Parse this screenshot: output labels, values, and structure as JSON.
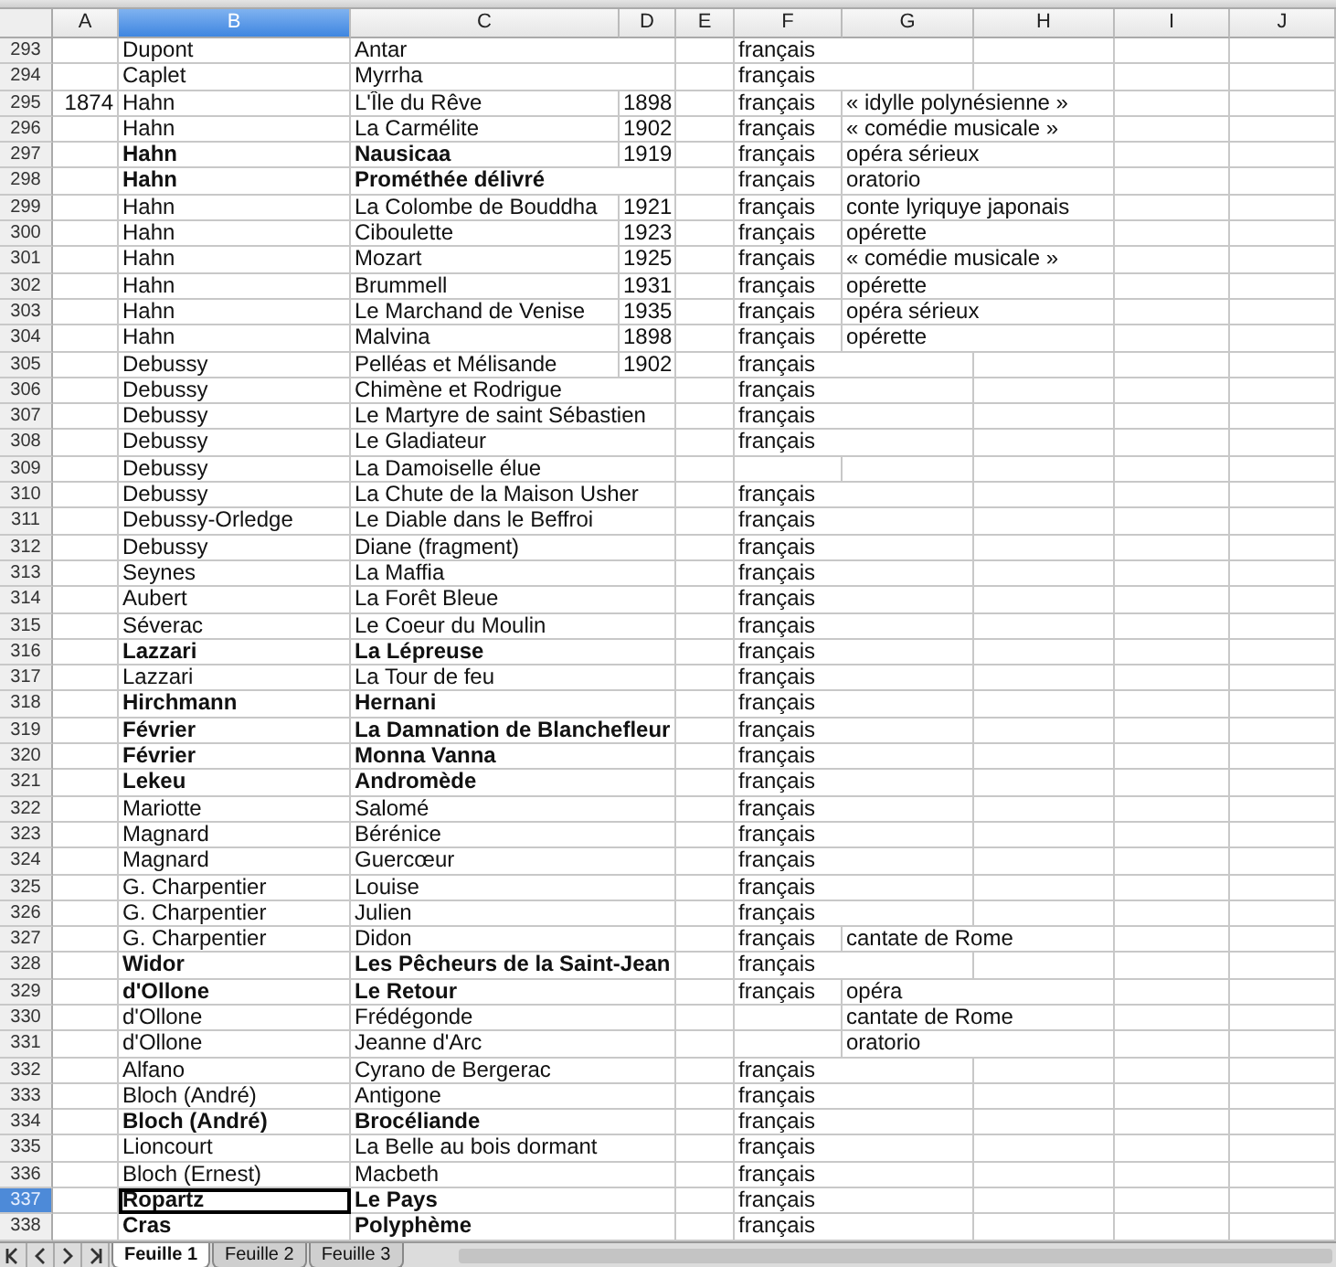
{
  "columns": [
    {
      "label": "A",
      "selected": false
    },
    {
      "label": "B",
      "selected": true
    },
    {
      "label": "C",
      "selected": false
    },
    {
      "label": "D",
      "selected": false
    },
    {
      "label": "E",
      "selected": false
    },
    {
      "label": "F",
      "selected": false
    },
    {
      "label": "G",
      "selected": false
    },
    {
      "label": "H",
      "selected": false
    },
    {
      "label": "I",
      "selected": false
    },
    {
      "label": "J",
      "selected": false
    }
  ],
  "rows": [
    {
      "num": "293",
      "cells": {
        "B": "Dupont",
        "C": "Antar",
        "F": "français"
      },
      "bold": false,
      "selected": false
    },
    {
      "num": "294",
      "cells": {
        "B": "Caplet",
        "C": "Myrrha",
        "F": "français"
      },
      "bold": false,
      "selected": false
    },
    {
      "num": "295",
      "cells": {
        "A": "1874",
        "B": "Hahn",
        "C": "L'Île du Rêve",
        "D": "1898",
        "F": "français",
        "G": "« idylle polynésienne »"
      },
      "bold": false,
      "selected": false
    },
    {
      "num": "296",
      "cells": {
        "B": "Hahn",
        "C": "La Carmélite",
        "D": "1902",
        "F": "français",
        "G": "« comédie musicale »"
      },
      "bold": false,
      "selected": false
    },
    {
      "num": "297",
      "cells": {
        "B": "Hahn",
        "C": "Nausicaa",
        "D": "1919",
        "F": "français",
        "G": "opéra sérieux"
      },
      "bold": true,
      "selected": false
    },
    {
      "num": "298",
      "cells": {
        "B": "Hahn",
        "C": "Prométhée délivré",
        "F": "français",
        "G": "oratorio"
      },
      "bold": true,
      "selected": false
    },
    {
      "num": "299",
      "cells": {
        "B": "Hahn",
        "C": "La Colombe de Bouddha",
        "D": "1921",
        "F": "français",
        "G": "conte lyriquye japonais"
      },
      "bold": false,
      "selected": false
    },
    {
      "num": "300",
      "cells": {
        "B": "Hahn",
        "C": "Ciboulette",
        "D": "1923",
        "F": "français",
        "G": "opérette"
      },
      "bold": false,
      "selected": false
    },
    {
      "num": "301",
      "cells": {
        "B": "Hahn",
        "C": "Mozart",
        "D": "1925",
        "F": "français",
        "G": "« comédie musicale »"
      },
      "bold": false,
      "selected": false
    },
    {
      "num": "302",
      "cells": {
        "B": "Hahn",
        "C": "Brummell",
        "D": "1931",
        "F": "français",
        "G": "opérette"
      },
      "bold": false,
      "selected": false
    },
    {
      "num": "303",
      "cells": {
        "B": "Hahn",
        "C": "Le Marchand de Venise",
        "D": "1935",
        "F": "français",
        "G": "opéra sérieux"
      },
      "bold": false,
      "selected": false
    },
    {
      "num": "304",
      "cells": {
        "B": "Hahn",
        "C": "Malvina",
        "D": "1898",
        "F": "français",
        "G": "opérette"
      },
      "bold": false,
      "selected": false
    },
    {
      "num": "305",
      "cells": {
        "B": "Debussy",
        "C": "Pelléas et Mélisande",
        "D": "1902",
        "F": "français"
      },
      "bold": false,
      "selected": false
    },
    {
      "num": "306",
      "cells": {
        "B": "Debussy",
        "C": "Chimène et Rodrigue",
        "F": "français"
      },
      "bold": false,
      "selected": false
    },
    {
      "num": "307",
      "cells": {
        "B": "Debussy",
        "C": "Le Martyre de saint Sébastien",
        "F": "français"
      },
      "bold": false,
      "selected": false
    },
    {
      "num": "308",
      "cells": {
        "B": "Debussy",
        "C": "Le Gladiateur",
        "F": "français"
      },
      "bold": false,
      "selected": false
    },
    {
      "num": "309",
      "cells": {
        "B": "Debussy",
        "C": "La Damoiselle élue"
      },
      "bold": false,
      "selected": false
    },
    {
      "num": "310",
      "cells": {
        "B": "Debussy",
        "C": "La Chute de la Maison Usher",
        "F": "français"
      },
      "bold": false,
      "selected": false
    },
    {
      "num": "311",
      "cells": {
        "B": "Debussy-Orledge",
        "C": "Le Diable dans le Beffroi",
        "F": "français"
      },
      "bold": false,
      "selected": false
    },
    {
      "num": "312",
      "cells": {
        "B": "Debussy",
        "C": "Diane (fragment)",
        "F": "français"
      },
      "bold": false,
      "selected": false
    },
    {
      "num": "313",
      "cells": {
        "B": "Seynes",
        "C": "La Maffia",
        "F": "français"
      },
      "bold": false,
      "selected": false
    },
    {
      "num": "314",
      "cells": {
        "B": "Aubert",
        "C": "La Forêt Bleue",
        "F": "français"
      },
      "bold": false,
      "selected": false
    },
    {
      "num": "315",
      "cells": {
        "B": "Séverac",
        "C": "Le Coeur du Moulin",
        "F": "français"
      },
      "bold": false,
      "selected": false
    },
    {
      "num": "316",
      "cells": {
        "B": "Lazzari",
        "C": "La Lépreuse",
        "F": "français"
      },
      "bold": true,
      "selected": false
    },
    {
      "num": "317",
      "cells": {
        "B": "Lazzari",
        "C": "La Tour de feu",
        "F": "français"
      },
      "bold": false,
      "selected": false
    },
    {
      "num": "318",
      "cells": {
        "B": "Hirchmann",
        "C": "Hernani",
        "F": "français"
      },
      "bold": true,
      "selected": false
    },
    {
      "num": "319",
      "cells": {
        "B": "Février",
        "C": "La Damnation de Blanchefleur",
        "F": "français"
      },
      "bold": true,
      "selected": false
    },
    {
      "num": "320",
      "cells": {
        "B": "Février",
        "C": "Monna Vanna",
        "F": "français"
      },
      "bold": true,
      "selected": false
    },
    {
      "num": "321",
      "cells": {
        "B": "Lekeu",
        "C": "Andromède",
        "F": "français"
      },
      "bold": true,
      "selected": false
    },
    {
      "num": "322",
      "cells": {
        "B": "Mariotte",
        "C": "Salomé",
        "F": "français"
      },
      "bold": false,
      "selected": false
    },
    {
      "num": "323",
      "cells": {
        "B": "Magnard",
        "C": "Bérénice",
        "F": "français"
      },
      "bold": false,
      "selected": false
    },
    {
      "num": "324",
      "cells": {
        "B": "Magnard",
        "C": "Guercœur",
        "F": "français"
      },
      "bold": false,
      "selected": false
    },
    {
      "num": "325",
      "cells": {
        "B": "G. Charpentier",
        "C": "Louise",
        "F": "français"
      },
      "bold": false,
      "selected": false
    },
    {
      "num": "326",
      "cells": {
        "B": "G. Charpentier",
        "C": "Julien",
        "F": "français"
      },
      "bold": false,
      "selected": false
    },
    {
      "num": "327",
      "cells": {
        "B": "G. Charpentier",
        "C": "Didon",
        "F": "français",
        "G": "cantate de Rome"
      },
      "bold": false,
      "selected": false
    },
    {
      "num": "328",
      "cells": {
        "B": "Widor",
        "C": "Les Pêcheurs de la Saint-Jean",
        "F": "français"
      },
      "bold": true,
      "selected": false
    },
    {
      "num": "329",
      "cells": {
        "B": "d'Ollone",
        "C": "Le Retour",
        "F": "français",
        "G": "opéra"
      },
      "bold": true,
      "selected": false
    },
    {
      "num": "330",
      "cells": {
        "B": "d'Ollone",
        "C": "Frédégonde",
        "G": "cantate de Rome"
      },
      "bold": false,
      "selected": false
    },
    {
      "num": "331",
      "cells": {
        "B": "d'Ollone",
        "C": "Jeanne d'Arc",
        "G": "oratorio"
      },
      "bold": false,
      "selected": false
    },
    {
      "num": "332",
      "cells": {
        "B": "Alfano",
        "C": "Cyrano de Bergerac",
        "F": "français"
      },
      "bold": false,
      "selected": false
    },
    {
      "num": "333",
      "cells": {
        "B": "Bloch (André)",
        "C": "Antigone",
        "F": "français"
      },
      "bold": false,
      "selected": false
    },
    {
      "num": "334",
      "cells": {
        "B": "Bloch (André)",
        "C": "Brocéliande",
        "F": "français"
      },
      "bold": true,
      "selected": false
    },
    {
      "num": "335",
      "cells": {
        "B": "Lioncourt",
        "C": "La Belle au bois dormant",
        "F": "français"
      },
      "bold": false,
      "selected": false
    },
    {
      "num": "336",
      "cells": {
        "B": "Bloch (Ernest)",
        "C": "Macbeth",
        "F": "français"
      },
      "bold": false,
      "selected": false
    },
    {
      "num": "337",
      "cells": {
        "B": "Ropartz",
        "C": "Le Pays",
        "F": "français"
      },
      "bold": true,
      "selected": true
    },
    {
      "num": "338",
      "cells": {
        "B": "Cras",
        "C": "Polyphème",
        "F": "français"
      },
      "bold": true,
      "selected": false
    }
  ],
  "sheet_tabs": [
    {
      "label": "Feuille 1",
      "selected": true
    },
    {
      "label": "Feuille 2",
      "selected": false
    },
    {
      "label": "Feuille 3",
      "selected": false
    }
  ]
}
